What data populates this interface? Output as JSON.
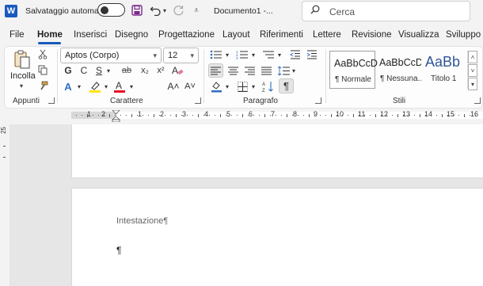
{
  "titlebar": {
    "logo_letter": "W",
    "autosave_label": "Salvataggio automatico",
    "autosave_on": false,
    "doc_title": "Documento1  -...",
    "search_placeholder": "Cerca",
    "icons": [
      "save-icon",
      "undo-icon",
      "redo-icon",
      "customize-qat-icon"
    ]
  },
  "tabs": [
    {
      "label": "File"
    },
    {
      "label": "Home",
      "active": true
    },
    {
      "label": "Inserisci"
    },
    {
      "label": "Disegno"
    },
    {
      "label": "Progettazione"
    },
    {
      "label": "Layout"
    },
    {
      "label": "Riferimenti"
    },
    {
      "label": "Lettere"
    },
    {
      "label": "Revisione"
    },
    {
      "label": "Visualizza"
    },
    {
      "label": "Sviluppo"
    }
  ],
  "ribbon": {
    "clipboard": {
      "paste_label": "Incolla",
      "group_label": "Appunti"
    },
    "font": {
      "font_name": "Aptos (Corpo)",
      "font_size": "12",
      "bold": "G",
      "italic": "C",
      "underline": "S",
      "strikethrough": "ab",
      "subscript": "x₂",
      "superscript": "x²",
      "text_effects": "A",
      "highlight": "A",
      "font_color": "A",
      "grow": "A˄",
      "shrink": "A˅",
      "group_label": "Carattere"
    },
    "paragraph": {
      "show_marks": "¶",
      "group_label": "Paragrafo"
    },
    "styles": {
      "items": [
        {
          "sample": "AaBbCcD",
          "name": "¶ Normale",
          "selected": true
        },
        {
          "sample": "AaBbCcD",
          "name": "¶ Nessuna..."
        },
        {
          "sample": "AaBb",
          "name": "Titolo 1"
        }
      ],
      "group_label": "Stili"
    }
  },
  "ruler": {
    "numbers": [
      "1",
      "2",
      "1",
      "2",
      "3",
      "4",
      "5",
      "6",
      "7",
      "8",
      "9",
      "10",
      "11",
      "12",
      "13",
      "14",
      "15",
      "16"
    ],
    "vertical_number": "25"
  },
  "document": {
    "header_text": "Intestazione¶",
    "body_mark": "¶"
  },
  "colors": {
    "accent": "#185abd",
    "highlight_yellow": "#ffe600",
    "font_color_red": "#e81123",
    "heading_blue": "#2f5597"
  }
}
